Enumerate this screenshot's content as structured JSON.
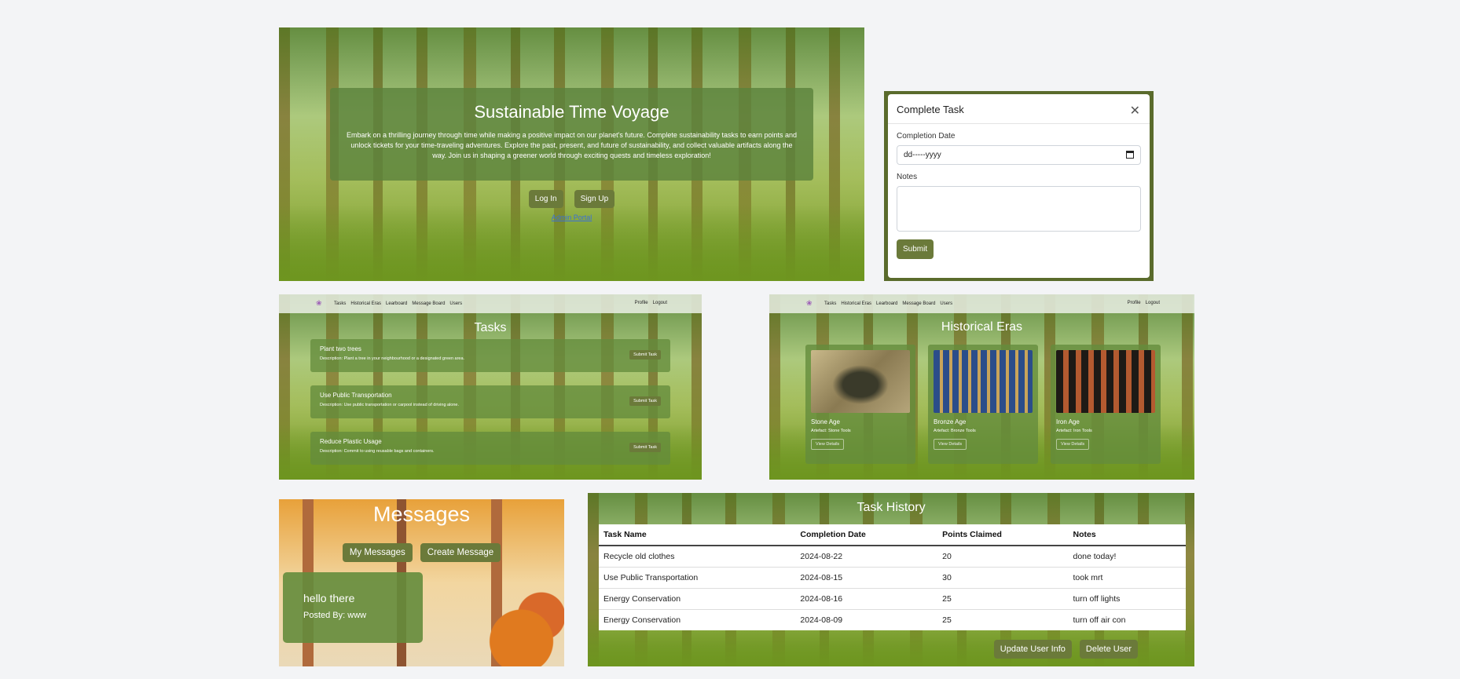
{
  "landing": {
    "title": "Sustainable Time Voyage",
    "description": "Embark on a thrilling journey through time while making a positive impact on our planet's future. Complete sustainability tasks to earn points and unlock tickets for your time-traveling adventures. Explore the past, present, and future of sustainability, and collect valuable artifacts along the way. Join us in shaping a greener world through exciting quests and timeless exploration!",
    "login_label": "Log In",
    "signup_label": "Sign Up",
    "admin_link": "Admin Portal"
  },
  "modal": {
    "title": "Complete Task",
    "date_label": "Completion Date",
    "date_placeholder": "dd-----yyyy",
    "notes_label": "Notes",
    "submit_label": "Submit"
  },
  "nav": {
    "links": [
      "Tasks",
      "Historical Eras",
      "Learboard",
      "Message Board",
      "Users"
    ],
    "right": [
      "Profile",
      "Logout"
    ]
  },
  "tasks": {
    "title": "Tasks",
    "items": [
      {
        "name": "Plant two trees",
        "desc": "Description: Plant a tree in your neighbourhood or a designated green area.",
        "btn": "Submit Task"
      },
      {
        "name": "Use Public Transportation",
        "desc": "Description: Use public transportation or carpool instead of driving alone.",
        "btn": "Submit Task"
      },
      {
        "name": "Reduce Plastic Usage",
        "desc": "Description: Commit to using reusable bags and containers.",
        "btn": "Submit Task"
      }
    ]
  },
  "eras": {
    "title": "Historical Eras",
    "items": [
      {
        "name": "Stone Age",
        "artefact": "Artefact: Stone Tools",
        "btn": "View Details"
      },
      {
        "name": "Bronze Age",
        "artefact": "Artefact: Bronze Tools",
        "btn": "View Details"
      },
      {
        "name": "Iron Age",
        "artefact": "Artefact: Iron Tools",
        "btn": "View Details"
      }
    ]
  },
  "messages": {
    "title": "Messages",
    "my_label": "My Messages",
    "create_label": "Create Message",
    "card": {
      "text": "hello there",
      "posted_by": "Posted By: www"
    }
  },
  "history": {
    "title": "Task History",
    "headers": [
      "Task Name",
      "Completion Date",
      "Points Claimed",
      "Notes"
    ],
    "rows": [
      [
        "Recycle old clothes",
        "2024-08-22",
        "20",
        "done today!"
      ],
      [
        "Use Public Transportation",
        "2024-08-15",
        "30",
        "took mrt"
      ],
      [
        "Energy Conservation",
        "2024-08-16",
        "25",
        "turn off lights"
      ],
      [
        "Energy Conservation",
        "2024-08-09",
        "25",
        "turn off air con"
      ]
    ],
    "update_label": "Update User Info",
    "delete_label": "Delete User"
  }
}
